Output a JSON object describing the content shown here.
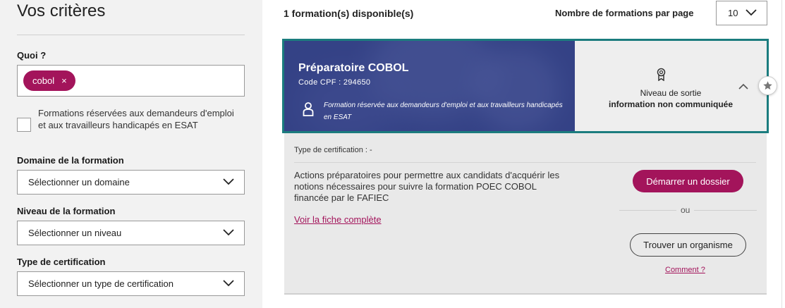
{
  "sidebar": {
    "title": "Vos critères",
    "quoi": {
      "label": "Quoi ?",
      "chip": "cobol",
      "chip_close": "×"
    },
    "checkbox_label": "Formations réservées aux demandeurs d'emploi et aux travailleurs handicapés en ESAT",
    "domaine": {
      "label": "Domaine de la formation",
      "value": "Sélectionner un domaine"
    },
    "niveau": {
      "label": "Niveau de la formation",
      "value": "Sélectionner un niveau"
    },
    "certification": {
      "label": "Type de certification",
      "value": "Sélectionner un type de certification"
    }
  },
  "header": {
    "count": "1 formation(s) disponible(s)",
    "per_page_label": "Nombre de formations par page",
    "per_page_value": "10"
  },
  "card": {
    "title": "Préparatoire COBOL",
    "code": "Code CPF : 294650",
    "note": "Formation réservée aux demandeurs d'emploi et aux travailleurs handicapés en ESAT",
    "niveau_label": "Niveau de sortie",
    "niveau_value": "information non communiquée"
  },
  "details": {
    "cert_type": "Type de certification : -",
    "description": "Actions préparatoires pour permettre aux candidats d'acquérir les notions nécessaires pour suivre la formation POEC COBOL financée par le FAFIEC",
    "fiche_link": "Voir la fiche complète",
    "start_button": "Démarrer un dossier",
    "ou": "ou",
    "org_button": "Trouver un organisme",
    "comment_link": "Comment ?"
  },
  "colors": {
    "accent": "#a3145b",
    "card_border": "#1b7c7e",
    "card_banner": "#3b4a8c"
  },
  "icons": [
    "close-icon",
    "chevron-down-icon",
    "chevron-up-icon",
    "person-icon",
    "medal-icon",
    "star-icon"
  ]
}
